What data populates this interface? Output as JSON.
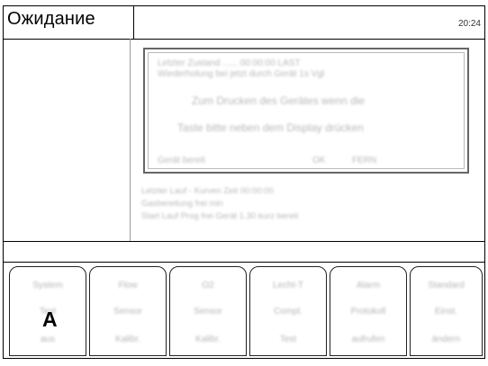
{
  "title": "Ожидание",
  "clock": "20:24",
  "dialog": {
    "line1": "Letzter Zustand ...... 00:00:00 LAST",
    "line2": "Wiederholung bei jetzt durch Gerät 1s Vgl",
    "line3": "Zum Drucken des Gerätes wenn die",
    "line4": "Taste bitte neben dem Display drücken",
    "footer_left": "Gerät bereit",
    "footer_mid": "OK",
    "footer_right": "FERN"
  },
  "info": {
    "line1": "Letzter Lauf - Kurven Zeit 00:00:00",
    "line2": "Gasbereitung frei min",
    "line3": "Start Lauf    Prog frei  Gerät 1.30 kurz bereit"
  },
  "softkeys": [
    {
      "line1": "System",
      "line2": "Test",
      "line3": "aus"
    },
    {
      "line1": "Flow",
      "line2": "Sensor",
      "line3": "Kalibr."
    },
    {
      "line1": "O2",
      "line2": "Sensor",
      "line3": "Kalibr."
    },
    {
      "line1": "Lecht-T",
      "line2": "Compl.",
      "line3": "Test"
    },
    {
      "line1": "Alarm",
      "line2": "Protokoll",
      "line3": "aufrufen"
    },
    {
      "line1": "Standard",
      "line2": "Einst.",
      "line3": "ändern"
    }
  ],
  "marker": "A"
}
